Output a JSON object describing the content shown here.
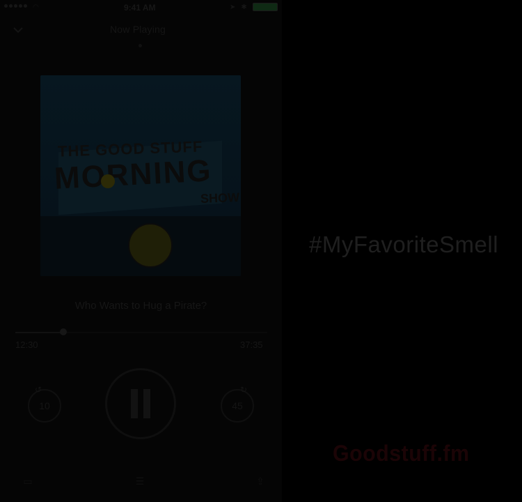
{
  "status_bar": {
    "time": "9:41 AM"
  },
  "header": {
    "now_playing": "Now Playing"
  },
  "episode": {
    "title": "Who Wants to Hug a Pirate?",
    "elapsed": "12:30",
    "remaining": "37:35",
    "progress_fraction": 0.19
  },
  "cover": {
    "line1": "THE GOOD STUFF",
    "line2": "MORNING",
    "line3": "SHOW"
  },
  "controls": {
    "skip_back": "10",
    "skip_forward": "45"
  },
  "right_panel": {
    "hashtag": "#MyFavoriteSmell",
    "logo": "Goodstuff.fm"
  },
  "icons": {
    "collapse": "chevron-down-icon",
    "pause": "pause-icon",
    "rewind": "rewind-icon",
    "forward": "forward-icon"
  }
}
